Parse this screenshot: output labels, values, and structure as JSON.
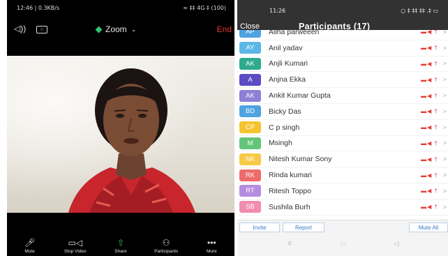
{
  "left": {
    "status": {
      "time": "12:46 | 0.3KB/s",
      "right": "≈ ‡‡ 4G ‡ (100)"
    },
    "top": {
      "zoom_label": "Zoom",
      "end_label": "End"
    },
    "toolbar": [
      {
        "label": "Mute",
        "icon": "⑀",
        "name": "mute"
      },
      {
        "label": "Stop Video",
        "icon": "▭",
        "name": "stop-video"
      },
      {
        "label": "Share",
        "icon": "⇧",
        "name": "share"
      },
      {
        "label": "Participants",
        "icon": "⚇",
        "name": "participants"
      },
      {
        "label": "More",
        "icon": "•••",
        "name": "more"
      }
    ]
  },
  "right": {
    "status": {
      "time": "11:26",
      "right": "○ ‡ ‡‡ ‡‡ .‡ ▭"
    },
    "close_label": "Close",
    "title": "Participants (17)",
    "participants": [
      {
        "initials": "AP",
        "name": "Aliha parweeen",
        "color": "#4fa3e0"
      },
      {
        "initials": "AY",
        "name": "Anil yadav",
        "color": "#5bb7e6"
      },
      {
        "initials": "AK",
        "name": "Anjli Kumari",
        "color": "#2eaa8f"
      },
      {
        "initials": "A",
        "name": "Anjna Ekka",
        "color": "#5b4bc4"
      },
      {
        "initials": "AK",
        "name": "Ankit Kumar Gupta",
        "color": "#8f7fd6"
      },
      {
        "initials": "BD",
        "name": "Bicky Das",
        "color": "#4fa3e0"
      },
      {
        "initials": "CP",
        "name": "C p singh",
        "color": "#f4c430"
      },
      {
        "initials": "M",
        "name": "Msingh",
        "color": "#63c57a"
      },
      {
        "initials": "NK",
        "name": "Nitesh Kumar Sony",
        "color": "#f7c948"
      },
      {
        "initials": "RK",
        "name": "Rinda kumari",
        "color": "#ef6b6b"
      },
      {
        "initials": "RT",
        "name": "Ritesh Toppo",
        "color": "#b58ce0"
      },
      {
        "initials": "SB",
        "name": "Sushila Burh",
        "color": "#f08db0"
      }
    ],
    "buttons": {
      "invite": "Invite",
      "report": "Report",
      "mute_all": "Mute All"
    },
    "nav": {
      "menu": "≡",
      "home": "▭",
      "back": "◁"
    }
  }
}
